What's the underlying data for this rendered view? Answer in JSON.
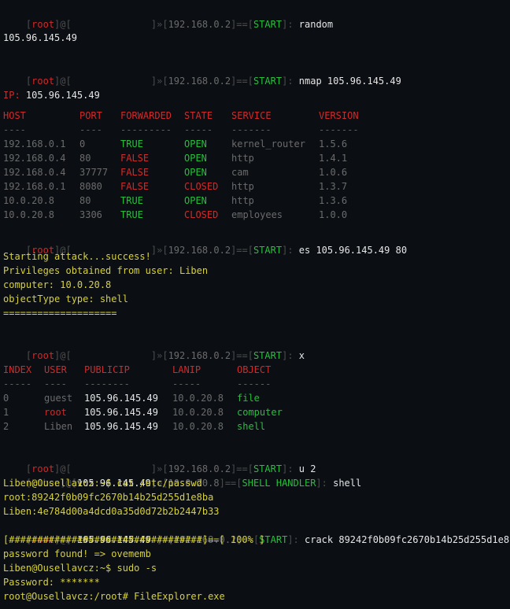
{
  "prompt": {
    "open": "[",
    "user": "root",
    "at": "]@[",
    "spacer": "              ",
    "mid": "]»[",
    "ip": "192.168.0.2",
    "eq": "]==[",
    "start": "START",
    "close": "]: "
  },
  "commands": {
    "c1": "random",
    "c2": "nmap 105.96.145.49",
    "c3": "es 105.96.145.49 80",
    "c4": "x",
    "c5": "u 2",
    "c8": "crack 89242f0b09fc2670b14b25d255d1e8ba"
  },
  "random_result": "105.96.145.49",
  "nmap": {
    "ip_label": "IP:",
    "ip_value": " 105.96.145.49",
    "headers": [
      "HOST",
      "PORT",
      "FORWARDED",
      "STATE",
      "SERVICE",
      "VERSION"
    ],
    "dashes": [
      "----",
      "----",
      "---------",
      "-----",
      "-------",
      "-------"
    ],
    "rows": [
      [
        "192.168.0.1",
        "0",
        "TRUE",
        "OPEN",
        "kernel_router",
        "1.5.6"
      ],
      [
        "192.168.0.4",
        "80",
        "FALSE",
        "OPEN",
        "http",
        "1.4.1"
      ],
      [
        "192.168.0.4",
        "37777",
        "FALSE",
        "OPEN",
        "cam",
        "1.0.6"
      ],
      [
        "192.168.0.1",
        "8080",
        "FALSE",
        "CLOSED",
        "http",
        "1.3.7"
      ],
      [
        "10.0.20.8",
        "80",
        "TRUE",
        "OPEN",
        "http",
        "1.3.6"
      ],
      [
        "10.0.20.8",
        "3306",
        "TRUE",
        "CLOSED",
        "employees",
        "1.0.0"
      ]
    ]
  },
  "attack": {
    "l1": "Starting attack...success!",
    "l2": "Privileges obtained from user: Liben",
    "l3_label": "computer:",
    "l3_value": " 10.0.20.8",
    "l4_label": "objectType type:",
    "l4_value": " shell",
    "l5": "===================="
  },
  "users": {
    "headers": [
      "INDEX",
      "USER",
      "PUBLICIP",
      "LANIP",
      "OBJECT"
    ],
    "dashes": [
      "-----",
      "----",
      "--------",
      "-----",
      "------"
    ],
    "rows": [
      [
        "0",
        "guest",
        "105.96.145.49",
        "10.0.20.8",
        "file"
      ],
      [
        "1",
        "root",
        "105.96.145.49",
        "10.0.20.8",
        "computer"
      ],
      [
        "2",
        "Liben",
        "105.96.145.49",
        "10.0.20.8",
        "shell"
      ]
    ]
  },
  "shell_prompt": {
    "open": "[",
    "user": "Liben",
    "at": "]@[",
    "pub": "105.96.145.49",
    "mid": "]»[",
    "lan": "10.0.20.8",
    "eq": "]==[",
    "handler": "SHELL HANDLER",
    "close": "]: ",
    "cmd": "shell"
  },
  "session": {
    "l1": "Liben@Ousellavcz:~$ cat /etc/passwd",
    "l2": "root:89242f0b09fc2670b14b25d255d1e8ba",
    "l3": "Liben:4e784d00a4dcd0a35d0d72b2b2447b33"
  },
  "crack_prompt": {
    "open": "[",
    "user": "root",
    "at": "]@[",
    "pub": " 105.96.145.49 ",
    "mid": "]»[",
    "ip": "192.168.0.2",
    "eq": "]==[",
    "start": "START",
    "close": "]: "
  },
  "tail": {
    "progress": "[##################################]==[ 100% ]",
    "found": "password found! => ovememb",
    "sudo": "Liben@Ousellavcz:~$ sudo -s",
    "password": "Password: *******",
    "final": "root@Ousellavcz:/root# FileExplorer.exe"
  },
  "colors": {
    "background": "#0b0e13",
    "text": "#e6e6e6",
    "red": "#d02a2a",
    "green": "#25c03a",
    "yellow": "#d8d232",
    "gray": "#4d4d4d"
  }
}
